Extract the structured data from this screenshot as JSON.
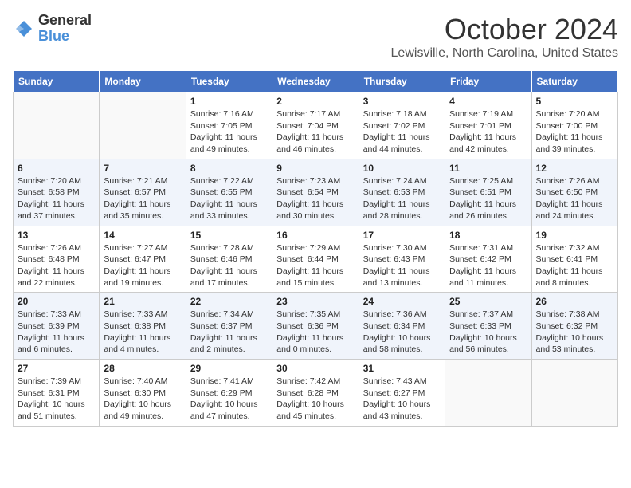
{
  "header": {
    "logo_general": "General",
    "logo_blue": "Blue",
    "month_title": "October 2024",
    "subtitle": "Lewisville, North Carolina, United States"
  },
  "days_of_week": [
    "Sunday",
    "Monday",
    "Tuesday",
    "Wednesday",
    "Thursday",
    "Friday",
    "Saturday"
  ],
  "weeks": [
    [
      {
        "day": "",
        "info": ""
      },
      {
        "day": "",
        "info": ""
      },
      {
        "day": "1",
        "sunrise": "Sunrise: 7:16 AM",
        "sunset": "Sunset: 7:05 PM",
        "daylight": "Daylight: 11 hours and 49 minutes."
      },
      {
        "day": "2",
        "sunrise": "Sunrise: 7:17 AM",
        "sunset": "Sunset: 7:04 PM",
        "daylight": "Daylight: 11 hours and 46 minutes."
      },
      {
        "day": "3",
        "sunrise": "Sunrise: 7:18 AM",
        "sunset": "Sunset: 7:02 PM",
        "daylight": "Daylight: 11 hours and 44 minutes."
      },
      {
        "day": "4",
        "sunrise": "Sunrise: 7:19 AM",
        "sunset": "Sunset: 7:01 PM",
        "daylight": "Daylight: 11 hours and 42 minutes."
      },
      {
        "day": "5",
        "sunrise": "Sunrise: 7:20 AM",
        "sunset": "Sunset: 7:00 PM",
        "daylight": "Daylight: 11 hours and 39 minutes."
      }
    ],
    [
      {
        "day": "6",
        "sunrise": "Sunrise: 7:20 AM",
        "sunset": "Sunset: 6:58 PM",
        "daylight": "Daylight: 11 hours and 37 minutes."
      },
      {
        "day": "7",
        "sunrise": "Sunrise: 7:21 AM",
        "sunset": "Sunset: 6:57 PM",
        "daylight": "Daylight: 11 hours and 35 minutes."
      },
      {
        "day": "8",
        "sunrise": "Sunrise: 7:22 AM",
        "sunset": "Sunset: 6:55 PM",
        "daylight": "Daylight: 11 hours and 33 minutes."
      },
      {
        "day": "9",
        "sunrise": "Sunrise: 7:23 AM",
        "sunset": "Sunset: 6:54 PM",
        "daylight": "Daylight: 11 hours and 30 minutes."
      },
      {
        "day": "10",
        "sunrise": "Sunrise: 7:24 AM",
        "sunset": "Sunset: 6:53 PM",
        "daylight": "Daylight: 11 hours and 28 minutes."
      },
      {
        "day": "11",
        "sunrise": "Sunrise: 7:25 AM",
        "sunset": "Sunset: 6:51 PM",
        "daylight": "Daylight: 11 hours and 26 minutes."
      },
      {
        "day": "12",
        "sunrise": "Sunrise: 7:26 AM",
        "sunset": "Sunset: 6:50 PM",
        "daylight": "Daylight: 11 hours and 24 minutes."
      }
    ],
    [
      {
        "day": "13",
        "sunrise": "Sunrise: 7:26 AM",
        "sunset": "Sunset: 6:48 PM",
        "daylight": "Daylight: 11 hours and 22 minutes."
      },
      {
        "day": "14",
        "sunrise": "Sunrise: 7:27 AM",
        "sunset": "Sunset: 6:47 PM",
        "daylight": "Daylight: 11 hours and 19 minutes."
      },
      {
        "day": "15",
        "sunrise": "Sunrise: 7:28 AM",
        "sunset": "Sunset: 6:46 PM",
        "daylight": "Daylight: 11 hours and 17 minutes."
      },
      {
        "day": "16",
        "sunrise": "Sunrise: 7:29 AM",
        "sunset": "Sunset: 6:44 PM",
        "daylight": "Daylight: 11 hours and 15 minutes."
      },
      {
        "day": "17",
        "sunrise": "Sunrise: 7:30 AM",
        "sunset": "Sunset: 6:43 PM",
        "daylight": "Daylight: 11 hours and 13 minutes."
      },
      {
        "day": "18",
        "sunrise": "Sunrise: 7:31 AM",
        "sunset": "Sunset: 6:42 PM",
        "daylight": "Daylight: 11 hours and 11 minutes."
      },
      {
        "day": "19",
        "sunrise": "Sunrise: 7:32 AM",
        "sunset": "Sunset: 6:41 PM",
        "daylight": "Daylight: 11 hours and 8 minutes."
      }
    ],
    [
      {
        "day": "20",
        "sunrise": "Sunrise: 7:33 AM",
        "sunset": "Sunset: 6:39 PM",
        "daylight": "Daylight: 11 hours and 6 minutes."
      },
      {
        "day": "21",
        "sunrise": "Sunrise: 7:33 AM",
        "sunset": "Sunset: 6:38 PM",
        "daylight": "Daylight: 11 hours and 4 minutes."
      },
      {
        "day": "22",
        "sunrise": "Sunrise: 7:34 AM",
        "sunset": "Sunset: 6:37 PM",
        "daylight": "Daylight: 11 hours and 2 minutes."
      },
      {
        "day": "23",
        "sunrise": "Sunrise: 7:35 AM",
        "sunset": "Sunset: 6:36 PM",
        "daylight": "Daylight: 11 hours and 0 minutes."
      },
      {
        "day": "24",
        "sunrise": "Sunrise: 7:36 AM",
        "sunset": "Sunset: 6:34 PM",
        "daylight": "Daylight: 10 hours and 58 minutes."
      },
      {
        "day": "25",
        "sunrise": "Sunrise: 7:37 AM",
        "sunset": "Sunset: 6:33 PM",
        "daylight": "Daylight: 10 hours and 56 minutes."
      },
      {
        "day": "26",
        "sunrise": "Sunrise: 7:38 AM",
        "sunset": "Sunset: 6:32 PM",
        "daylight": "Daylight: 10 hours and 53 minutes."
      }
    ],
    [
      {
        "day": "27",
        "sunrise": "Sunrise: 7:39 AM",
        "sunset": "Sunset: 6:31 PM",
        "daylight": "Daylight: 10 hours and 51 minutes."
      },
      {
        "day": "28",
        "sunrise": "Sunrise: 7:40 AM",
        "sunset": "Sunset: 6:30 PM",
        "daylight": "Daylight: 10 hours and 49 minutes."
      },
      {
        "day": "29",
        "sunrise": "Sunrise: 7:41 AM",
        "sunset": "Sunset: 6:29 PM",
        "daylight": "Daylight: 10 hours and 47 minutes."
      },
      {
        "day": "30",
        "sunrise": "Sunrise: 7:42 AM",
        "sunset": "Sunset: 6:28 PM",
        "daylight": "Daylight: 10 hours and 45 minutes."
      },
      {
        "day": "31",
        "sunrise": "Sunrise: 7:43 AM",
        "sunset": "Sunset: 6:27 PM",
        "daylight": "Daylight: 10 hours and 43 minutes."
      },
      {
        "day": "",
        "info": ""
      },
      {
        "day": "",
        "info": ""
      }
    ]
  ]
}
